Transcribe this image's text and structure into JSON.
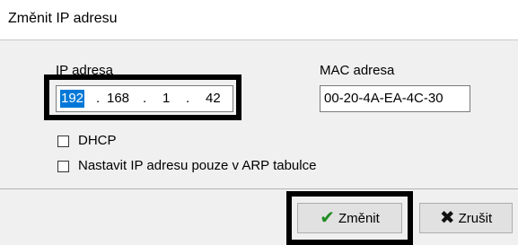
{
  "window": {
    "title": "Změnit IP adresu"
  },
  "ip": {
    "label": "IP adresa",
    "octets": [
      "192",
      "168",
      "1",
      "42"
    ],
    "dots": [
      ".",
      ".",
      "."
    ]
  },
  "mac": {
    "label": "MAC adresa",
    "value": "00-20-4A-EA-4C-30"
  },
  "options": {
    "dhcp": {
      "label": "DHCP",
      "checked": false
    },
    "arp": {
      "label": "Nastavit IP adresu pouze v ARP tabulce",
      "checked": false
    }
  },
  "buttons": {
    "ok": {
      "label": "Změnit",
      "icon": "checkmark-icon"
    },
    "cancel": {
      "label": "Zrušit",
      "icon": "x-icon"
    }
  }
}
